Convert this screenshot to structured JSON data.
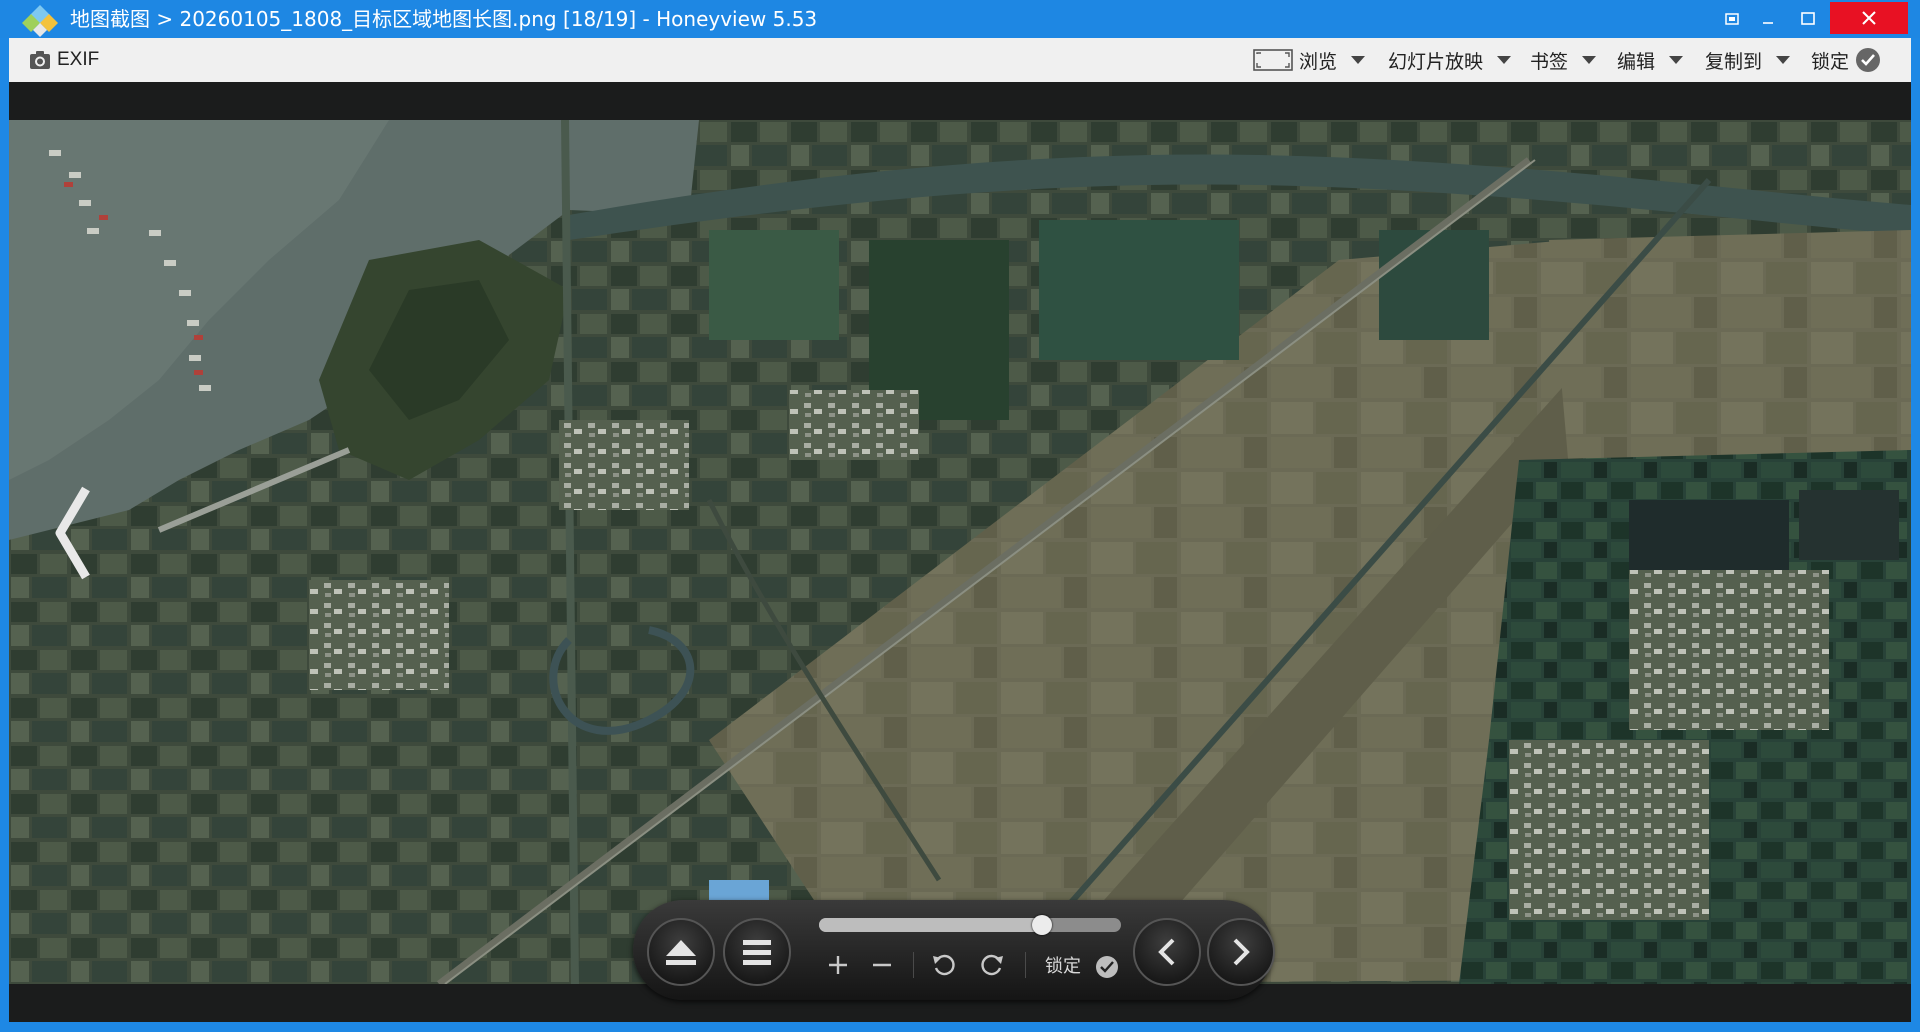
{
  "window": {
    "title": "地图截图 > 20260105_1808_目标区域地图长图.png [18/19] - Honeyview 5.53"
  },
  "toolbar": {
    "exif_label": "EXIF",
    "browse_label": "浏览",
    "slideshow_label": "幻灯片放映",
    "bookmark_label": "书签",
    "edit_label": "编辑",
    "copy_to_label": "复制到",
    "lock_label": "锁定"
  },
  "controls": {
    "zoom_slider_value": 0.74,
    "lock_label": "锁定"
  },
  "colors": {
    "titlebar": "#1e87e3",
    "close_button": "#e81123",
    "toolbar": "#f0f0f0",
    "viewer_background": "#1b1c1c"
  },
  "icons": {
    "app": "honeyview-logo-icon",
    "exif": "camera-icon",
    "browse": "frame-icon",
    "lock": "check-circle-icon"
  }
}
